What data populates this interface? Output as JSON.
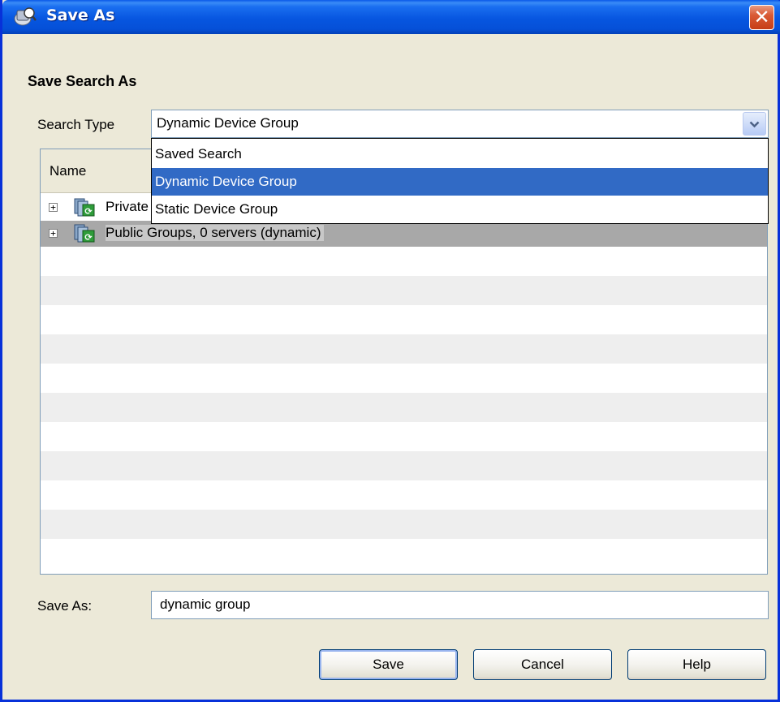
{
  "window": {
    "title": "Save As",
    "close_label": "✕"
  },
  "heading": "Save Search As",
  "search_type": {
    "label": "Search Type",
    "value": "Dynamic Device Group",
    "arrow": "⌄",
    "options": [
      "Saved Search",
      "Dynamic Device Group",
      "Static Device Group"
    ],
    "selected_index": 1
  },
  "table": {
    "column_name": "Name",
    "rows": [
      {
        "label": "Private Groups, 0 servers (dynamic)",
        "visible_label": "Private",
        "expander": "+"
      },
      {
        "label": "Public Groups, 0 servers (dynamic)",
        "expander": "+",
        "selected": true
      }
    ]
  },
  "save_as": {
    "label": "Save As:",
    "value": "dynamic group"
  },
  "buttons": {
    "save": "Save",
    "cancel": "Cancel",
    "help": "Help"
  },
  "colors": {
    "selection_blue": "#316ac5",
    "title_blue": "#0a58e8",
    "row_selected_gray": "#a8a8a8"
  },
  "icons": {
    "title": "server-search-icon",
    "group": "dynamic-group-icon",
    "close": "close-icon"
  }
}
